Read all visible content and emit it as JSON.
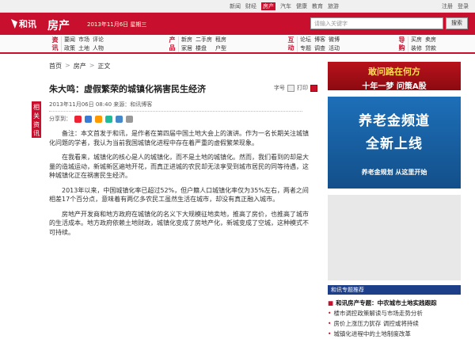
{
  "topbar": {
    "links": [
      "新闻",
      "财经",
      "房产",
      "汽车",
      "健康",
      "教育",
      "旅游"
    ],
    "login": [
      "注册",
      "登录"
    ]
  },
  "header": {
    "logo_text": "和讯",
    "channel": "房产",
    "date": "2013年11月6日 星期三",
    "search_placeholder": "请输入关键字",
    "search_button": "搜索"
  },
  "nav": [
    {
      "head": "资讯",
      "items": [
        "要闻",
        "市场",
        "评论",
        "政策",
        "土地",
        "人物"
      ]
    },
    {
      "head": "产品",
      "items": [
        "新房",
        "二手房",
        "租房",
        "家居",
        "楼盘",
        "户型"
      ]
    },
    {
      "head": "互动",
      "items": [
        "论坛",
        "博客",
        "微博",
        "专题",
        "调查",
        "活动"
      ]
    },
    {
      "head": "导购",
      "items": [
        "买房",
        "卖房",
        "装修",
        "贷款"
      ]
    }
  ],
  "breadcrumb": [
    "首页",
    "房产",
    "正文"
  ],
  "sidetab": "相关资讯",
  "article": {
    "title": "朱大鸣：虚假繁荣的城镇化祸害民生经济",
    "tools": [
      "字号",
      "打印"
    ],
    "meta": "2013年11月06日 08:40  来源：和讯博客",
    "share_label": "分享到：",
    "paragraphs": [
      "备注：本文首发于和讯，是作者在第四届中国土地大会上的演讲。作为一名长期关注城镇化问题的学者，我认为当前我国城镇化进程中存在着严重的虚假繁荣现象。",
      "在我看来，城镇化的核心是人的城镇化，而不是土地的城镇化。然而，我们看到的却是大量的造城运动，新城新区遍地开花，而真正进城的农民却无法享受到城市居民的同等待遇，这种城镇化正在祸害民生经济。",
      "2013年以来，中国城镇化率已超过52%，但户籍人口城镇化率仅为35%左右，两者之间相差17个百分点，意味着有两亿多农民工虽然生活在城市，却没有真正融入城市。",
      "房地产开发商和地方政府在城镇化的名义下大规模征地卖地，推高了房价，也推高了城市的生活成本。地方政府依赖土地财政，城镇化变成了房地产化，新城变成了空城，这种模式不可持续。"
    ]
  },
  "right": {
    "ad1_line1": "敢问路在何方",
    "ad1_line2": "十年一梦 问策A股",
    "ad2_line1": "养老金频道",
    "ad2_line2": "全新上线",
    "ad2_line3": "养老金规划 从这里开始",
    "ad3": "和讯专题推荐",
    "list": [
      "和讯房产专题：中农城市土地实践跟踪",
      "楼市调控政策解读与市场走势分析",
      "房价上涨压力犹存 调控或将持续",
      "城镇化进程中的土地制度改革"
    ]
  },
  "colors": {
    "brand_red": "#c8102e",
    "link_blue": "#1a4fa0"
  }
}
